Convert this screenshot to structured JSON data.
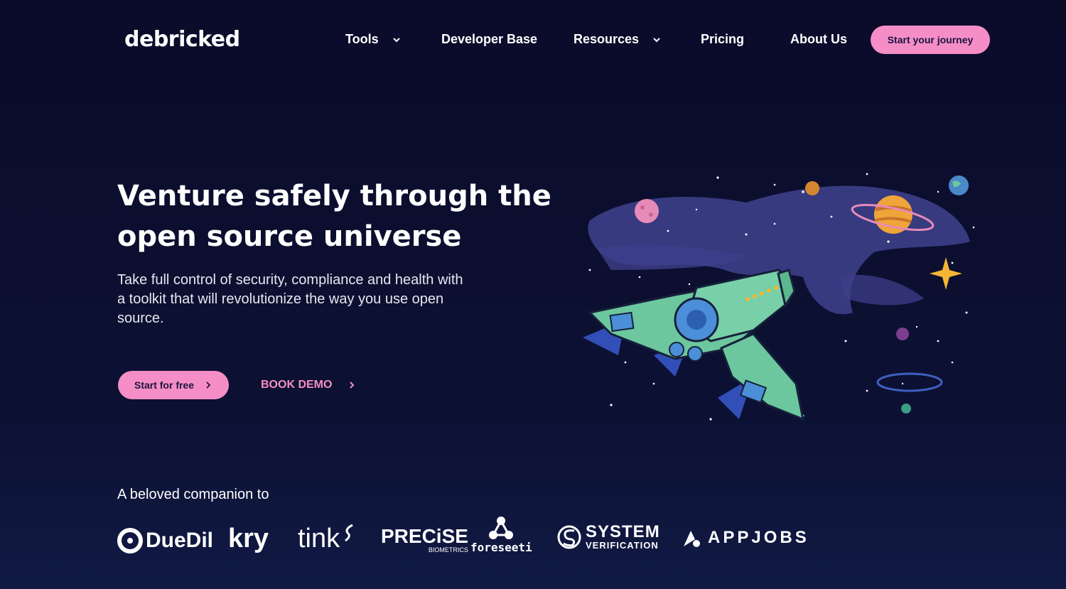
{
  "header": {
    "logo": "debricked",
    "nav": [
      {
        "label": "Tools",
        "has_dropdown": true
      },
      {
        "label": "Developer Base",
        "has_dropdown": false
      },
      {
        "label": "Resources",
        "has_dropdown": true
      },
      {
        "label": "Pricing",
        "has_dropdown": false
      },
      {
        "label": "About Us",
        "has_dropdown": false
      }
    ],
    "cta": "Start your journey"
  },
  "hero": {
    "title": "Venture safely through the open source universe",
    "subtitle": "Take full control of security, compliance and health with a toolkit that will revolutionize the way you use open source.",
    "primary_button": "Start for free",
    "secondary_link": "BOOK DEMO"
  },
  "companions": {
    "heading": "A beloved companion to",
    "logos": [
      {
        "name": "DueDil",
        "text": "DueDil"
      },
      {
        "name": "kry",
        "text": "kry"
      },
      {
        "name": "tink",
        "text": "tink"
      },
      {
        "name": "Precise Biometrics",
        "text": "PRECiSE",
        "subtext": "BIOMETRICS"
      },
      {
        "name": "foreseeti",
        "text": "foreseeti"
      },
      {
        "name": "System Verification",
        "text": "SYSTEM",
        "subtext": "VERIFICATION"
      },
      {
        "name": "AppJobs",
        "text": "APPJOBS"
      }
    ]
  },
  "colors": {
    "background": "#0b0b2a",
    "accent_pink": "#f58ec6",
    "ship_green": "#6cc79e",
    "nebula": "#3d3f8a"
  },
  "icons": {
    "nav_dropdown": "chevron-down-icon",
    "button_arrow": "chevron-right-icon"
  }
}
